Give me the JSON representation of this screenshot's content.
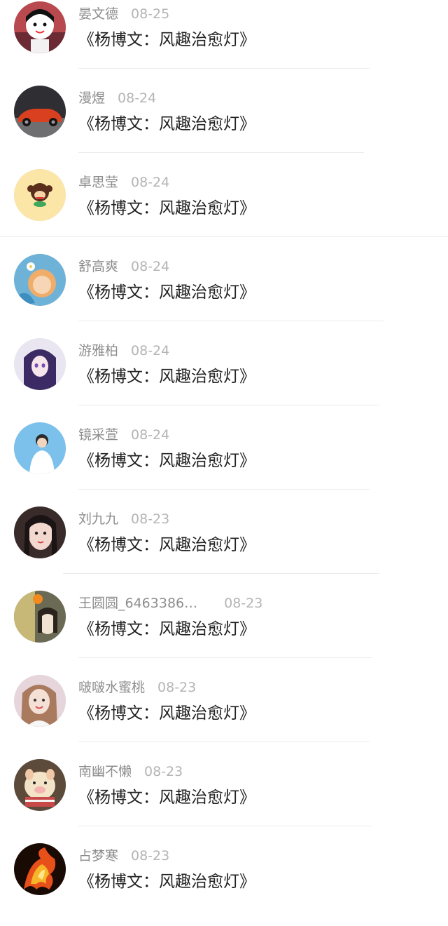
{
  "comments": [
    {
      "name": "晏文德",
      "date": "08-25",
      "title": "《杨博文：风趣治愈灯》",
      "avatar": "cartoon-avatar"
    },
    {
      "name": "漫煜",
      "date": "08-24",
      "title": "《杨博文：风趣治愈灯》",
      "avatar": "car-avatar"
    },
    {
      "name": "卓思莹",
      "date": "08-24",
      "title": "《杨博文：风趣治愈灯》",
      "avatar": "monkey-avatar"
    },
    {
      "name": "舒高爽",
      "date": "08-24",
      "title": "《杨博文：风趣治愈灯》",
      "avatar": "illustration-avatar"
    },
    {
      "name": "游雅柏",
      "date": "08-24",
      "title": "《杨博文：风趣治愈灯》",
      "avatar": "anime-girl-avatar"
    },
    {
      "name": "镜采萱",
      "date": "08-24",
      "title": "《杨博文：风趣治愈灯》",
      "avatar": "person-avatar"
    },
    {
      "name": "刘九九",
      "date": "08-23",
      "title": "《杨博文：风趣治愈灯》",
      "avatar": "selfie-avatar"
    },
    {
      "name": "王圆圆_6463386…",
      "date": "08-23",
      "title": "《杨博文：风趣治愈灯》",
      "avatar": "photo-avatar"
    },
    {
      "name": "啵啵水蜜桃",
      "date": "08-23",
      "title": "《杨博文：风趣治愈灯》",
      "avatar": "girl-avatar"
    },
    {
      "name": "南幽不懒",
      "date": "08-23",
      "title": "《杨博文：风趣治愈灯》",
      "avatar": "pig-toy-avatar"
    },
    {
      "name": "占梦寒",
      "date": "08-23",
      "title": "《杨博文：风趣治愈灯》",
      "avatar": "fire-horse-avatar"
    }
  ]
}
